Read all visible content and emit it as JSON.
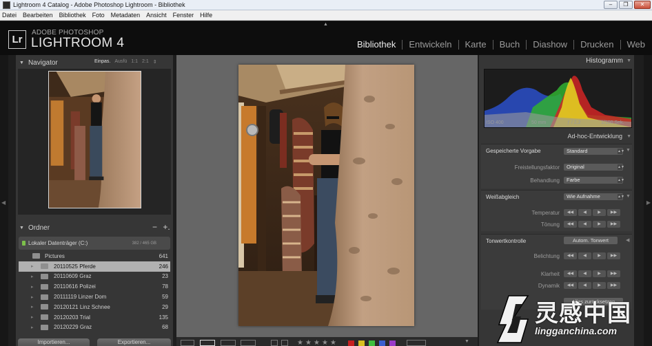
{
  "window": {
    "title": "Lightroom 4 Catalog - Adobe Photoshop Lightroom - Bibliothek",
    "minimize": "–",
    "restore": "❐",
    "close": "✕"
  },
  "menu": [
    "Datei",
    "Bearbeiten",
    "Bibliothek",
    "Foto",
    "Metadaten",
    "Ansicht",
    "Fenster",
    "Hilfe"
  ],
  "brand": {
    "logo": "Lr",
    "top": "ADOBE PHOTOSHOP",
    "main": "LIGHTROOM 4"
  },
  "modules": [
    {
      "label": "Bibliothek",
      "active": true
    },
    {
      "label": "Entwickeln",
      "active": false
    },
    {
      "label": "Karte",
      "active": false
    },
    {
      "label": "Buch",
      "active": false
    },
    {
      "label": "Diashow",
      "active": false
    },
    {
      "label": "Drucken",
      "active": false
    },
    {
      "label": "Web",
      "active": false
    }
  ],
  "navigator": {
    "title": "Navigator",
    "zoom": [
      "Einpas.",
      "Ausfü",
      "1:1",
      "2:1"
    ],
    "zoom_selected": "Einpas."
  },
  "folders": {
    "title": "Ordner",
    "minus": "−",
    "plus": "+.",
    "volume": {
      "label": "Lokaler Datenträger (C:)",
      "count": "382 / 465 GB"
    },
    "root": {
      "name": "Pictures",
      "count": "641"
    },
    "items": [
      {
        "name": "20110525 Pferde",
        "count": "246",
        "selected": true
      },
      {
        "name": "20110609 Graz",
        "count": "23",
        "selected": false
      },
      {
        "name": "20110616 Polizei",
        "count": "78",
        "selected": false
      },
      {
        "name": "20111119 Linzer Dom",
        "count": "59",
        "selected": false
      },
      {
        "name": "20120121 Linz Schnee",
        "count": "29",
        "selected": false
      },
      {
        "name": "20120203 Trial",
        "count": "135",
        "selected": false
      },
      {
        "name": "20120229 Graz",
        "count": "68",
        "selected": false
      }
    ]
  },
  "left_buttons": {
    "import": "Importieren...",
    "export": "Exportieren..."
  },
  "histogram": {
    "title": "Histogramm",
    "iso": "ISO 400",
    "focal": "50 mm",
    "aperture": "ƒ / 2,2",
    "shutter": "1/100 Sek."
  },
  "develop": {
    "title": "Ad-hoc-Entwicklung",
    "preset_label": "Gespeicherte Vorgabe",
    "preset_value": "Standard",
    "crop_label": "Freistellungsfaktor",
    "crop_value": "Original",
    "treatment_label": "Behandlung",
    "treatment_value": "Farbe",
    "wb_label": "Weißabgleich",
    "wb_value": "Wie Aufnahme",
    "temp_label": "Temperatur",
    "tint_label": "Tönung",
    "tone_label": "Tonwertkontrolle",
    "auto_tone": "Autom. Tonwert",
    "exposure_label": "Belichtung",
    "clarity_label": "Klarheit",
    "vibrance_label": "Dynamik",
    "reset_label": "Alles zurücksetzen"
  },
  "watermark": {
    "cn": "灵感中国",
    "en": "lingganchina.com"
  },
  "colors": {
    "panel": "#363636",
    "center": "#666666",
    "selected_row": "#b1b1b1",
    "accent_red": "#c62020",
    "accent_green": "#3fbf3f"
  }
}
